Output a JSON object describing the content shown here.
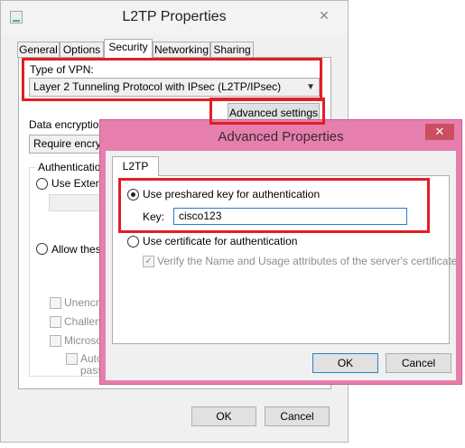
{
  "window": {
    "title": "L2TP Properties",
    "close_glyph": "✕",
    "icon": "network-connection-icon"
  },
  "tabs": [
    {
      "label": "General"
    },
    {
      "label": "Options"
    },
    {
      "label": "Security"
    },
    {
      "label": "Networking"
    },
    {
      "label": "Sharing"
    }
  ],
  "security": {
    "vpn_type_label": "Type of VPN:",
    "vpn_type_value": "Layer 2 Tunneling Protocol with IPsec (L2TP/IPsec)",
    "advanced_settings_label": "Advanced settings",
    "data_encryption_label": "Data encryption:",
    "data_encryption_value": "Require encrypt",
    "authentication_label": "Authentication",
    "use_extensible_label": "Use Extens",
    "allow_these_label": "Allow these",
    "unencrypted_label": "Unencry",
    "challenge_label": "Challeng",
    "microsoft_label": "Microsof",
    "auto_label": "Auto",
    "pass_label": "pass"
  },
  "footer": {
    "ok_label": "OK",
    "cancel_label": "Cancel"
  },
  "dialog": {
    "title": "Advanced Properties",
    "close_glyph": "✕",
    "tab_label": "L2TP",
    "preshared_label": "Use preshared key for authentication",
    "key_label": "Key:",
    "key_value": "cisco123",
    "certificate_label": "Use certificate for authentication",
    "verify_label": "Verify the Name and Usage attributes of the server's certificate",
    "ok_label": "OK",
    "cancel_label": "Cancel"
  },
  "colors": {
    "highlight_red": "#e31e24",
    "dialog_frame_pink": "#e67fae",
    "close_red": "#c94f61"
  }
}
